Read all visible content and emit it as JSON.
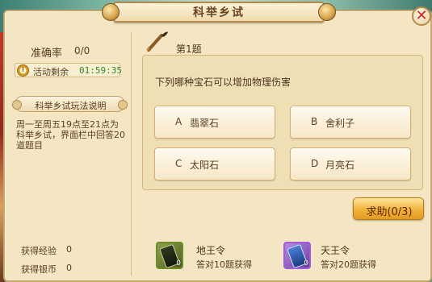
{
  "window": {
    "title": "科举乡试",
    "close_icon": "close-icon"
  },
  "left": {
    "accuracy_label": "准确率",
    "accuracy_value": "0/0",
    "timer_label": "活动剩余",
    "timer_value": "01:59:35",
    "rules_button": "科举乡试玩法说明",
    "rules_desc": "周一至周五19点至21点为科举乡试，界面栏中回答20道题目",
    "exp_label": "获得经验",
    "exp_value": "0",
    "silver_label": "获得银币",
    "silver_value": "0"
  },
  "question": {
    "number": "第1题",
    "text": "下列哪种宝石可以增加物理伤害",
    "options": [
      {
        "letter": "A",
        "text": "翡翠石"
      },
      {
        "letter": "B",
        "text": "舍利子"
      },
      {
        "letter": "C",
        "text": "太阳石"
      },
      {
        "letter": "D",
        "text": "月亮石"
      }
    ]
  },
  "help_button": "求助(0/3)",
  "rewards": [
    {
      "name": "地王令",
      "desc": "答对10题获得",
      "count": "0",
      "icon": "earth-token-icon",
      "color": "#6b8a2a"
    },
    {
      "name": "天王令",
      "desc": "答对20题获得",
      "count": "0",
      "icon": "heaven-token-icon",
      "color": "#a25ad8"
    }
  ],
  "colors": {
    "panel_bg": "#f4e6c2",
    "timer_green": "#2e8a2e",
    "close_red": "#d0281c",
    "help_gold": "#f2b23c"
  }
}
